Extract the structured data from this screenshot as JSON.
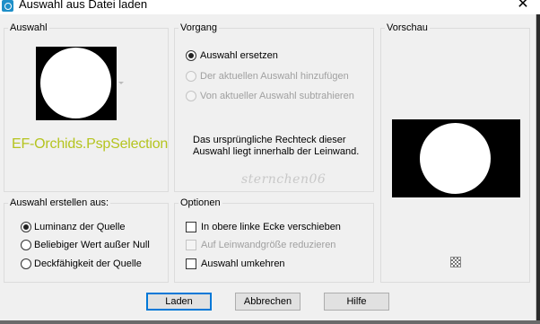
{
  "window": {
    "title": "Auswahl aus Datei laden",
    "app_icon": "psp-selection-icon",
    "close_glyph": "✕"
  },
  "auswahl": {
    "group_label": "Auswahl",
    "file_name": "EF-Orchids.PspSelection",
    "file_name_color": "#b5c41f"
  },
  "vorgang": {
    "group_label": "Vorgang",
    "options": [
      {
        "label": "Auswahl ersetzen",
        "checked": true,
        "enabled": true
      },
      {
        "label": "Der aktuellen Auswahl hinzufügen",
        "checked": false,
        "enabled": false
      },
      {
        "label": "Von aktueller Auswahl subtrahieren",
        "checked": false,
        "enabled": false
      }
    ],
    "info_text": "Das ursprüngliche Rechteck dieser Auswahl liegt innerhalb der Leinwand.",
    "watermark": "sternchen06"
  },
  "vorschau": {
    "group_label": "Vorschau",
    "transparency_icon": "checkerboard-icon"
  },
  "erstellen": {
    "group_label": "Auswahl erstellen aus:",
    "options": [
      {
        "label": "Luminanz der Quelle",
        "checked": true
      },
      {
        "label": "Beliebiger Wert außer Null",
        "checked": false
      },
      {
        "label": "Deckfähigkeit der Quelle",
        "checked": false
      }
    ]
  },
  "optionen": {
    "group_label": "Optionen",
    "options": [
      {
        "label": "In obere linke Ecke verschieben",
        "checked": false,
        "enabled": true
      },
      {
        "label": "Auf Leinwandgröße reduzieren",
        "checked": false,
        "enabled": false
      },
      {
        "label": "Auswahl umkehren",
        "checked": false,
        "enabled": true
      }
    ]
  },
  "buttons": {
    "load": "Laden",
    "cancel": "Abbrechen",
    "help": "Hilfe"
  },
  "colors": {
    "accent": "#0078d7",
    "dialog_bg": "#f0f0f0"
  }
}
